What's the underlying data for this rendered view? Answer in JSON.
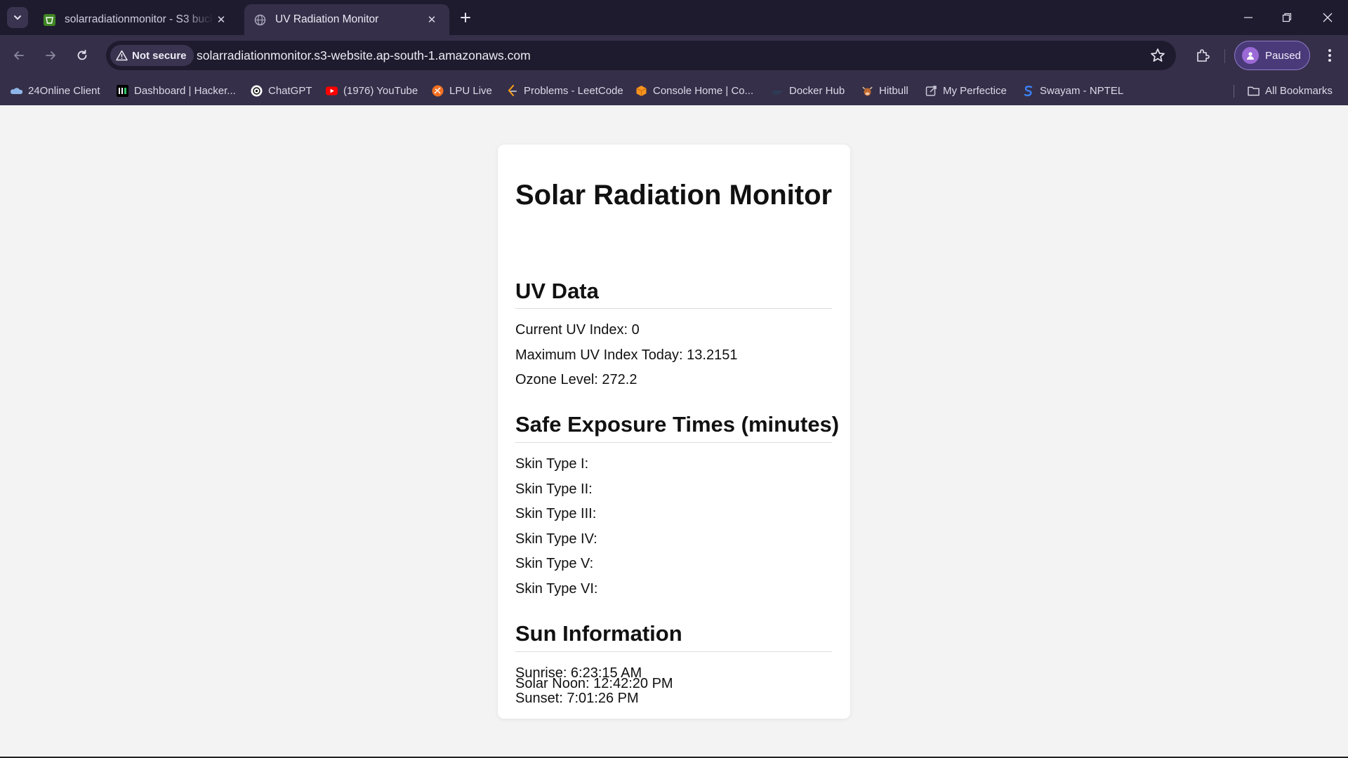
{
  "browser": {
    "tabs": [
      {
        "title": "solarradiationmonitor - S3 bucket",
        "favicon": "s3-bucket-icon",
        "active": false
      },
      {
        "title": "UV Radiation Monitor",
        "favicon": "globe-icon",
        "active": true
      }
    ],
    "security_label": "Not secure",
    "url": "solarradiationmonitor.s3-website.ap-south-1.amazonaws.com",
    "profile_label": "Paused",
    "bookmarks": [
      {
        "label": "24Online Client",
        "icon": "cloud-icon"
      },
      {
        "label": "Dashboard | Hacker...",
        "icon": "hackerrank-icon"
      },
      {
        "label": "ChatGPT",
        "icon": "chatgpt-icon"
      },
      {
        "label": "(1976) YouTube",
        "icon": "youtube-icon"
      },
      {
        "label": "LPU Live",
        "icon": "lpu-icon"
      },
      {
        "label": "Problems - LeetCode",
        "icon": "leetcode-icon"
      },
      {
        "label": "Console Home | Co...",
        "icon": "aws-cube-icon"
      },
      {
        "label": "Docker Hub",
        "icon": "docker-icon"
      },
      {
        "label": "Hitbull",
        "icon": "hitbull-icon"
      },
      {
        "label": "My Perfectice",
        "icon": "perfectice-icon"
      },
      {
        "label": "Swayam - NPTEL",
        "icon": "swayam-icon"
      }
    ],
    "all_bookmarks_label": "All Bookmarks",
    "colors": {
      "frame": "#1f1b2e",
      "toolbar": "#352f49",
      "profile": "#4b3a7a"
    }
  },
  "page": {
    "title": "Solar Radiation Monitor",
    "uv": {
      "heading": "UV Data",
      "current": "Current UV Index: 0",
      "max": "Maximum UV Index Today: 13.2151",
      "ozone": "Ozone Level: 272.2"
    },
    "exposure": {
      "heading": "Safe Exposure Times (minutes)",
      "skin_types": [
        "Skin Type I:",
        "Skin Type II:",
        "Skin Type III:",
        "Skin Type IV:",
        "Skin Type V:",
        "Skin Type VI:"
      ]
    },
    "sun": {
      "heading": "Sun Information",
      "sunrise": "Sunrise: 6:23:15 AM",
      "sunset": "Sunset: 7:01:26 PM",
      "solar_noon": "Solar Noon: 12:42:20 PM"
    }
  }
}
